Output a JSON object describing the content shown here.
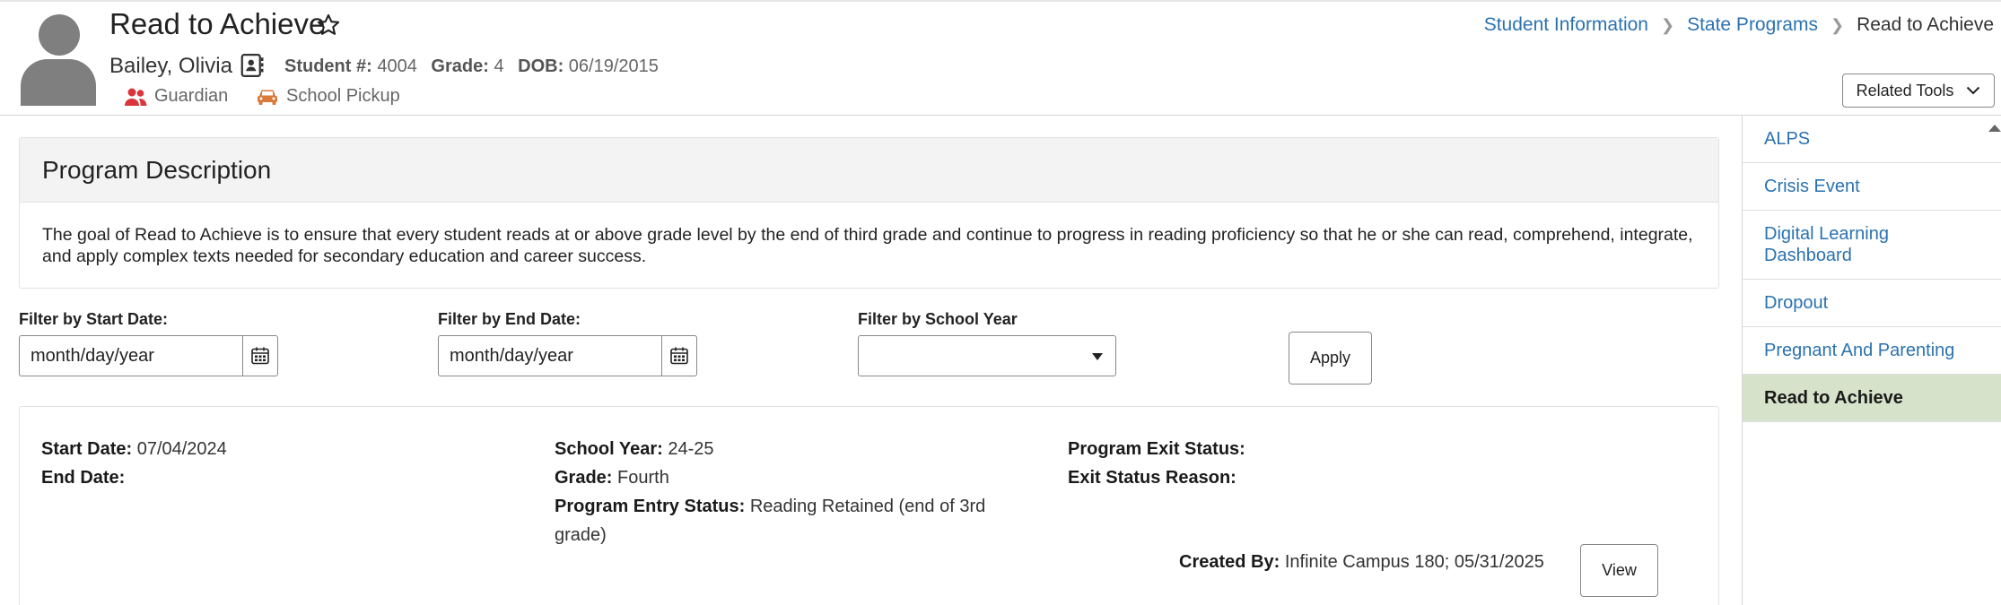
{
  "header": {
    "title": "Read to Achieve",
    "student_name": "Bailey, Olivia",
    "student_number_label": "Student #:",
    "student_number": "4004",
    "grade_label": "Grade:",
    "grade": "4",
    "dob_label": "DOB:",
    "dob": "06/19/2015",
    "tags": [
      {
        "label": "Guardian",
        "icon": "guardian-icon",
        "color": "#d9353a"
      },
      {
        "label": "School Pickup",
        "icon": "car-icon",
        "color": "#d9793a"
      }
    ]
  },
  "breadcrumb": {
    "items": [
      "Student Information",
      "State Programs"
    ],
    "current": "Read to Achieve"
  },
  "related_tools": {
    "label": "Related Tools"
  },
  "sidebar": {
    "items": [
      {
        "label": "ALPS",
        "active": false
      },
      {
        "label": "Crisis Event",
        "active": false
      },
      {
        "label": "Digital Learning Dashboard",
        "active": false
      },
      {
        "label": "Dropout",
        "active": false
      },
      {
        "label": "Pregnant And Parenting",
        "active": false
      },
      {
        "label": "Read to Achieve",
        "active": true
      }
    ]
  },
  "program_description": {
    "heading": "Program Description",
    "text": "The goal of Read to Achieve is to ensure that every student reads at or above grade level by the end of third grade and continue to progress in reading proficiency so that he or she can read, comprehend, integrate, and apply complex texts needed for secondary education and career success."
  },
  "filters": {
    "start_label": "Filter by Start Date:",
    "start_placeholder": "month/day/year",
    "end_label": "Filter by End Date:",
    "end_placeholder": "month/day/year",
    "year_label": "Filter by School Year",
    "year_value": "",
    "apply_label": "Apply"
  },
  "record": {
    "start_date_label": "Start Date:",
    "start_date": "07/04/2024",
    "end_date_label": "End Date:",
    "end_date": "",
    "school_year_label": "School Year:",
    "school_year": "24-25",
    "grade_label": "Grade:",
    "grade": "Fourth",
    "entry_status_label": "Program Entry Status:",
    "entry_status": "Reading Retained (end of 3rd grade)",
    "exit_status_label": "Program Exit Status:",
    "exit_status": "",
    "exit_reason_label": "Exit Status Reason:",
    "exit_reason": "",
    "created_by_label": "Created By:",
    "created_by": "Infinite Campus 180; 05/31/2025",
    "view_label": "View"
  },
  "colors": {
    "link": "#2b72b0",
    "active_bg": "#d6e2c9",
    "panel_header_bg": "#f3f3f3"
  }
}
